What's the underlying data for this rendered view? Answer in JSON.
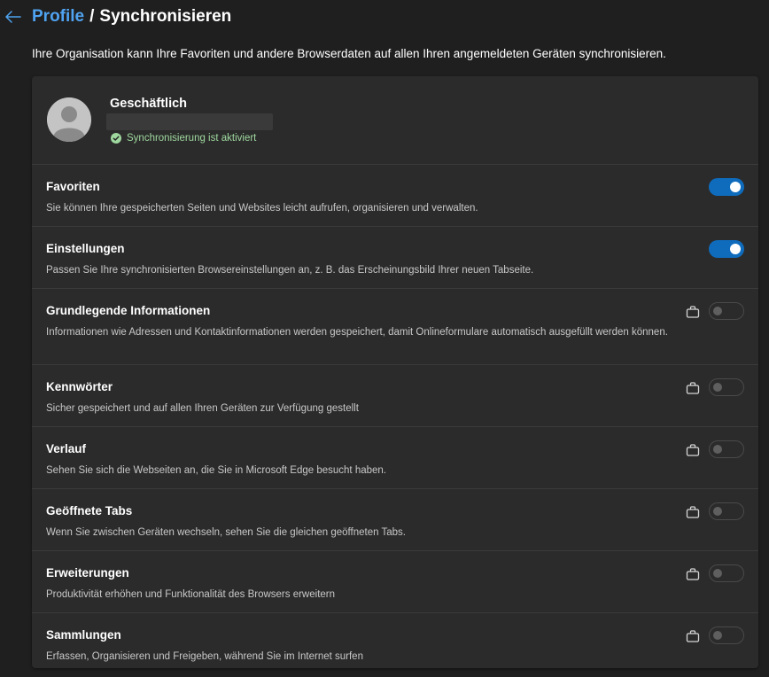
{
  "header": {
    "back_icon": "arrow-left-icon",
    "breadcrumb_link": "Profile",
    "breadcrumb_separator": "/",
    "page_title": "Synchronisieren"
  },
  "intro_text": "Ihre Organisation kann Ihre Favoriten und andere Browserdaten auf allen Ihren angemeldeten Geräten synchronisieren.",
  "account": {
    "name": "Geschäftlich",
    "email": "",
    "status": "Synchronisierung ist aktiviert",
    "status_icon": "check-circle-icon",
    "avatar_icon": "person-avatar-icon"
  },
  "items": [
    {
      "title": "Favoriten",
      "description": "Sie können Ihre gespeicherten Seiten und Websites leicht aufrufen, organisieren und verwalten.",
      "enabled": true,
      "locked": false
    },
    {
      "title": "Einstellungen",
      "description": "Passen Sie Ihre synchronisierten Browsereinstellungen an, z. B. das Erscheinungsbild Ihrer neuen Tabseite.",
      "enabled": true,
      "locked": false
    },
    {
      "title": "Grundlegende Informationen",
      "description": "Informationen wie Adressen und Kontaktinformationen werden gespeichert, damit Onlineformulare automatisch ausgefüllt werden können.",
      "enabled": false,
      "locked": true
    },
    {
      "title": "Kennwörter",
      "description": "Sicher gespeichert und auf allen Ihren Geräten zur Verfügung gestellt",
      "enabled": false,
      "locked": true
    },
    {
      "title": "Verlauf",
      "description": "Sehen Sie sich die Webseiten an, die Sie in Microsoft Edge besucht haben.",
      "enabled": false,
      "locked": true
    },
    {
      "title": "Geöffnete Tabs",
      "description": "Wenn Sie zwischen Geräten wechseln, sehen Sie die gleichen geöffneten Tabs.",
      "enabled": false,
      "locked": true
    },
    {
      "title": "Erweiterungen",
      "description": "Produktivität erhöhen und Funktionalität des Browsers erweitern",
      "enabled": false,
      "locked": true
    },
    {
      "title": "Sammlungen",
      "description": "Erfassen, Organisieren und Freigeben, während Sie im Internet surfen",
      "enabled": false,
      "locked": true
    }
  ],
  "colors": {
    "accent": "#0f6cbd",
    "link": "#4fa3f0",
    "status_green": "#9fd89f",
    "background": "#1f1f1f",
    "card": "#2b2b2b"
  }
}
